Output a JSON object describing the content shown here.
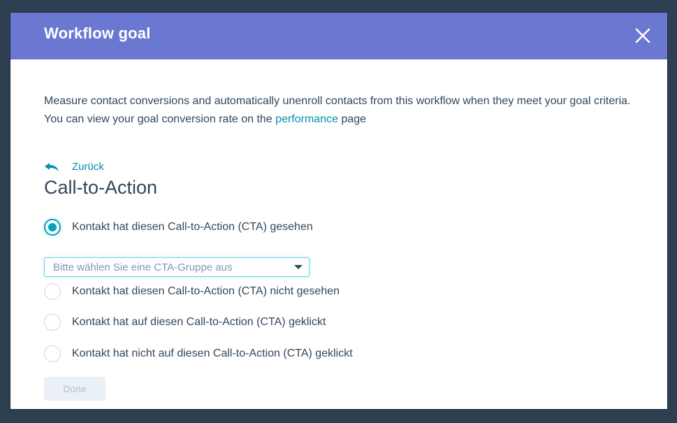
{
  "modal": {
    "title": "Workflow goal",
    "close_icon": "close-icon"
  },
  "body": {
    "description_line1": "Measure contact conversions and automatically unenroll contacts from this workflow when they meet your goal criteria.",
    "description_line2_prefix": "You can view your goal conversion rate on the ",
    "description_link": "performance",
    "description_line2_suffix": " page",
    "back_label": "Zurück",
    "back_icon": "reply-arrow-icon",
    "section_title": "Call-to-Action"
  },
  "options": [
    {
      "label": "Kontakt hat diesen Call-to-Action (CTA) gesehen",
      "checked": true
    },
    {
      "label": "Kontakt hat diesen Call-to-Action (CTA) nicht gesehen",
      "checked": false
    },
    {
      "label": "Kontakt hat auf diesen Call-to-Action (CTA) geklickt",
      "checked": false
    },
    {
      "label": "Kontakt hat nicht auf diesen Call-to-Action (CTA) geklickt",
      "checked": false
    }
  ],
  "cta_select": {
    "placeholder": "Bitte wählen Sie eine CTA-Gruppe aus"
  },
  "footer": {
    "done_label": "Done"
  },
  "colors": {
    "header": "#6a78d1",
    "accent": "#00a4bd",
    "link": "#0091ae",
    "text": "#33475b"
  }
}
